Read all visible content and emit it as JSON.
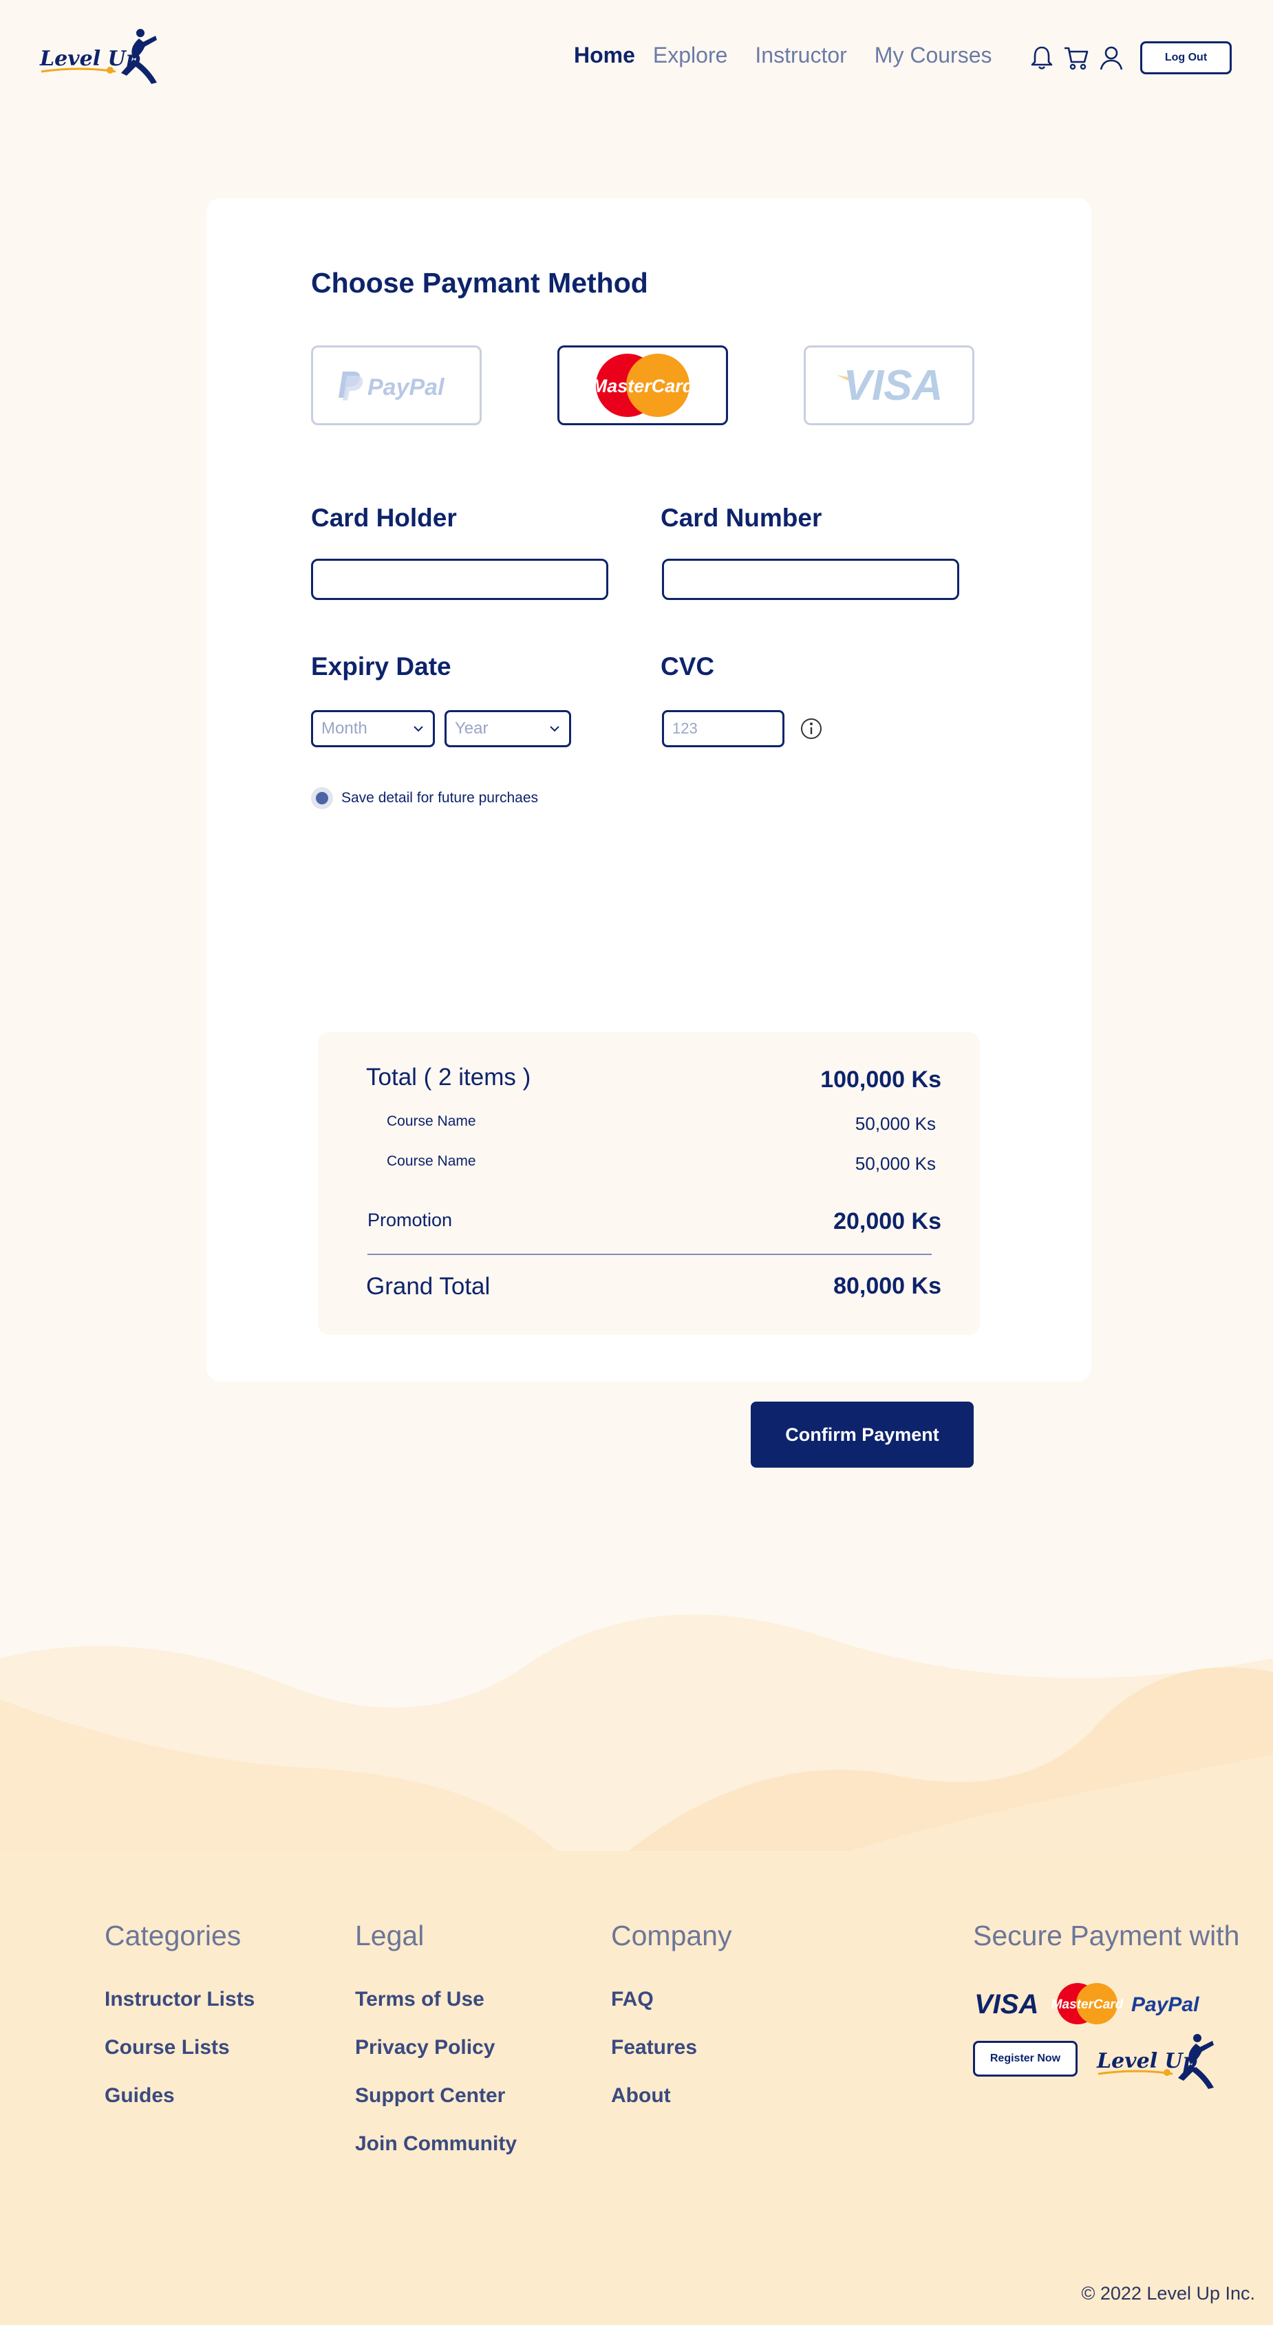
{
  "nav": {
    "logo_text": "Level Up",
    "links": [
      {
        "label": "Home",
        "active": true
      },
      {
        "label": "Explore",
        "active": false
      },
      {
        "label": "Instructor",
        "active": false
      },
      {
        "label": "My Courses",
        "active": false
      }
    ],
    "icons": [
      "bell-icon",
      "cart-icon",
      "user-icon"
    ],
    "logout_label": "Log Out"
  },
  "payment": {
    "title": "Choose Paymant Method",
    "methods": [
      {
        "name": "PayPal",
        "selected": false
      },
      {
        "name": "MasterCard",
        "selected": true
      },
      {
        "name": "VISA",
        "selected": false
      }
    ],
    "card_holder_label": "Card Holder",
    "card_holder_value": "",
    "card_number_label": "Card Number",
    "card_number_value": "",
    "expiry_label": "Expiry Date",
    "month_placeholder": "Month",
    "year_placeholder": "Year",
    "cvc_label": "CVC",
    "cvc_placeholder": "123",
    "save_label": "Save detail for future purchaes"
  },
  "summary": {
    "total_label": "Total ( 2 items )",
    "total_value": "100,000 Ks",
    "items": [
      {
        "name": "Course Name",
        "price": "50,000 Ks"
      },
      {
        "name": "Course Name",
        "price": "50,000 Ks"
      }
    ],
    "promotion_label": "Promotion",
    "promotion_value": "20,000 Ks",
    "grand_total_label": "Grand Total",
    "grand_total_value": "80,000 Ks"
  },
  "confirm_label": "Confirm Payment",
  "footer": {
    "columns": [
      {
        "heading": "Categories",
        "links": [
          "Instructor Lists",
          "Course Lists",
          "Guides"
        ]
      },
      {
        "heading": "Legal",
        "links": [
          "Terms of Use",
          "Privacy Policy",
          "Support Center",
          "Join Community"
        ]
      },
      {
        "heading": "Company",
        "links": [
          "FAQ",
          "Features",
          "About"
        ]
      }
    ],
    "secure_heading": "Secure Payment with",
    "payment_logos": [
      "VISA",
      "MasterCard",
      "PayPal"
    ],
    "register_label": "Register Now",
    "logo_text": "Level Up",
    "copyright": "© 2022 Level Up Inc."
  },
  "colors": {
    "primary": "#0d236b",
    "muted": "#6b7ba7",
    "page_bg": "#fdf8f2",
    "footer_bg": "#fdebcd",
    "mastercard_red": "#eb001b",
    "mastercard_orange": "#f79e1b"
  }
}
